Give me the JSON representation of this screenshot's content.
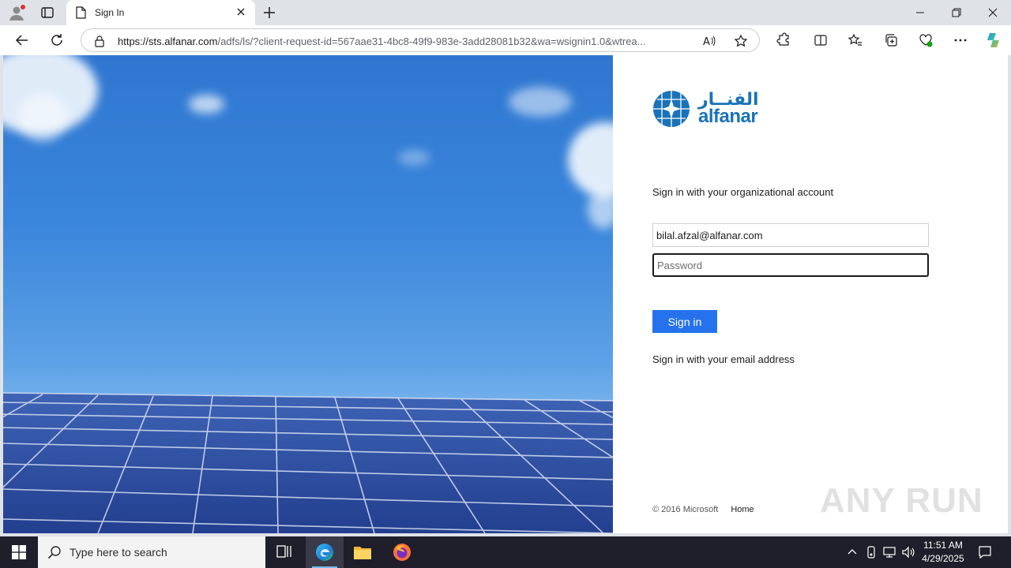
{
  "browser": {
    "tab_title": "Sign In",
    "url_domain": "https://sts.alfanar.com",
    "url_rest": "/adfs/ls/?client-request-id=567aae31-4bc8-49f9-983e-3add28081b32&wa=wsignin1.0&wtrea..."
  },
  "page": {
    "logo_arabic": "الفنــار",
    "logo_english": "alfanar",
    "heading": "Sign in with your organizational account",
    "email_value": "bilal.afzal@alfanar.com",
    "password_placeholder": "Password",
    "signin_label": "Sign in",
    "alt_signin_label": "Sign in with your email address",
    "copyright": "© 2016 Microsoft",
    "home_label": "Home",
    "watermark": "ANY RUN"
  },
  "taskbar": {
    "search_placeholder": "Type here to search",
    "time": "11:51 AM",
    "date": "4/29/2025"
  },
  "colors": {
    "accent": "#2672ec",
    "brand": "#1a73b8"
  }
}
